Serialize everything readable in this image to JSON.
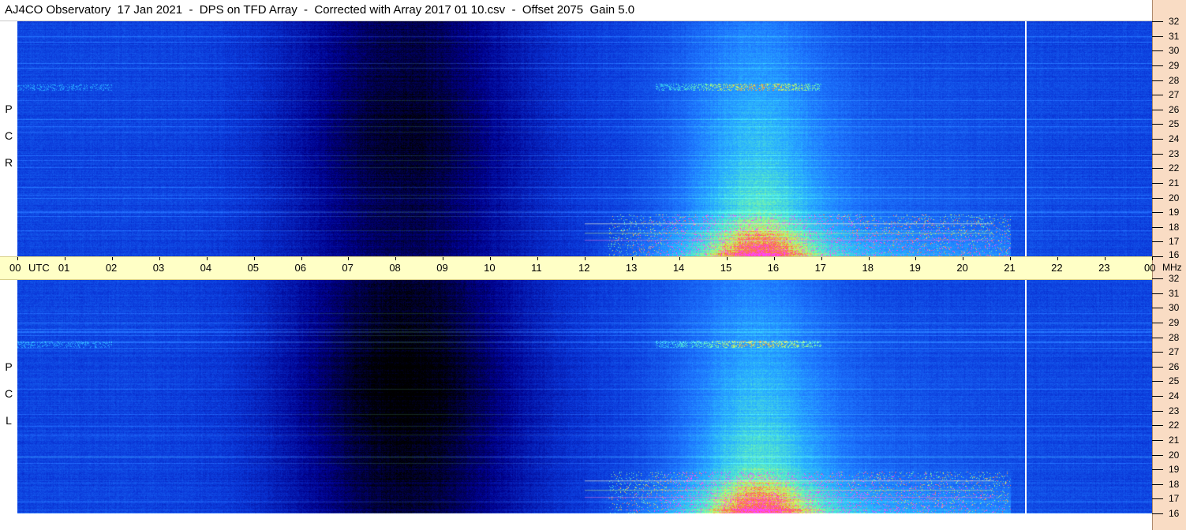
{
  "title": "AJ4CO Observatory  17 Jan 2021  -  DPS on TFD Array  -  Corrected with Array 2017 01 10.csv  -  Offset 2075  Gain 5.0",
  "panels": [
    {
      "id": "rcp",
      "label_letters": [
        "R",
        "C",
        "P"
      ]
    },
    {
      "id": "lcp",
      "label_letters": [
        "L",
        "C",
        "P"
      ]
    }
  ],
  "time_axis": {
    "labels": [
      "00",
      "UTC",
      "01",
      "02",
      "03",
      "04",
      "05",
      "06",
      "07",
      "08",
      "09",
      "10",
      "11",
      "12",
      "13",
      "14",
      "15",
      "16",
      "17",
      "18",
      "19",
      "20",
      "21",
      "22",
      "23",
      "00"
    ],
    "unit_label": "MHz"
  },
  "chart_data": {
    "type": "heatmap",
    "title": "AJ4CO Observatory  17 Jan 2021  -  DPS on TFD Array  -  Corrected with Array 2017 01 10.csv  -  Offset 2075  Gain 5.0",
    "x_unit": "UTC hour",
    "x_range": [
      0,
      24
    ],
    "x_ticks": [
      "00",
      "01",
      "02",
      "03",
      "04",
      "05",
      "06",
      "07",
      "08",
      "09",
      "10",
      "11",
      "12",
      "13",
      "14",
      "15",
      "16",
      "17",
      "18",
      "19",
      "20",
      "21",
      "22",
      "23",
      "00"
    ],
    "y_unit": "MHz",
    "y_range": [
      16,
      32
    ],
    "y_ticks": [
      32,
      31,
      30,
      29,
      28,
      27,
      26,
      25,
      24,
      23,
      22,
      21,
      20,
      19,
      18,
      17,
      16
    ],
    "series": [
      {
        "name": "RCP",
        "panel_label": "R C P"
      },
      {
        "name": "LCP",
        "panel_label": "L C P"
      }
    ],
    "marker_hour": 21.32,
    "colormap": [
      "#000000",
      "#00008c",
      "#0a37d8",
      "#1e78ff",
      "#2ab4ff",
      "#5aeec8",
      "#d2f25a",
      "#ff6a3a",
      "#ff44ff"
    ]
  }
}
